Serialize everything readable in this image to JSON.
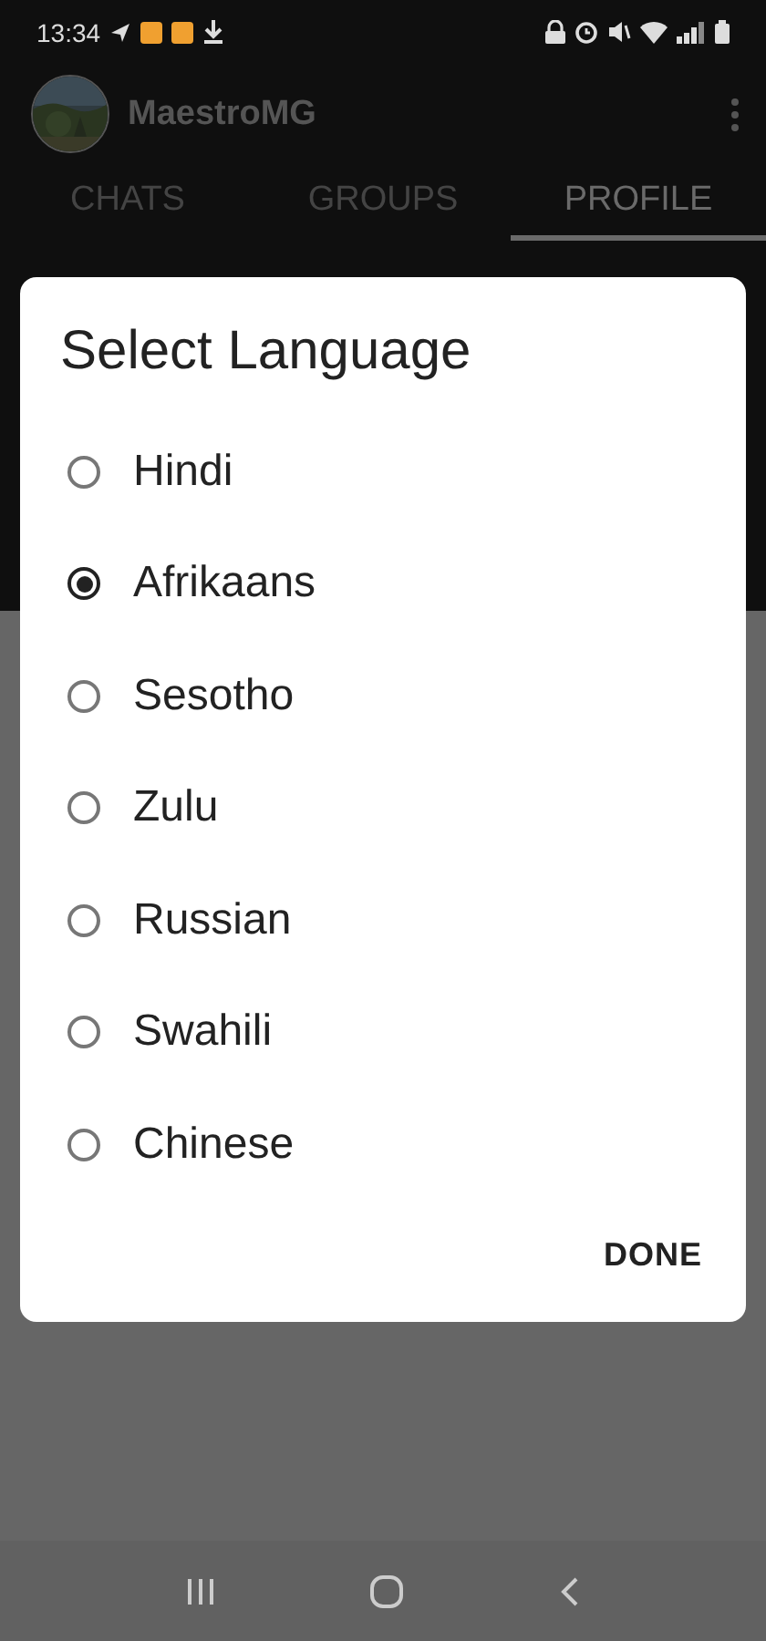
{
  "status_bar": {
    "time": "13:34"
  },
  "app_bar": {
    "title": "MaestroMG"
  },
  "tabs": [
    {
      "label": "CHATS",
      "selected": false
    },
    {
      "label": "GROUPS",
      "selected": false
    },
    {
      "label": "PROFILE",
      "selected": true
    }
  ],
  "dialog": {
    "title": "Select Language",
    "options": [
      {
        "label": "Hindi",
        "selected": false
      },
      {
        "label": "Afrikaans",
        "selected": true
      },
      {
        "label": "Sesotho",
        "selected": false
      },
      {
        "label": "Zulu",
        "selected": false
      },
      {
        "label": "Russian",
        "selected": false
      },
      {
        "label": "Swahili",
        "selected": false
      },
      {
        "label": "Chinese",
        "selected": false
      }
    ],
    "button": "DONE"
  }
}
